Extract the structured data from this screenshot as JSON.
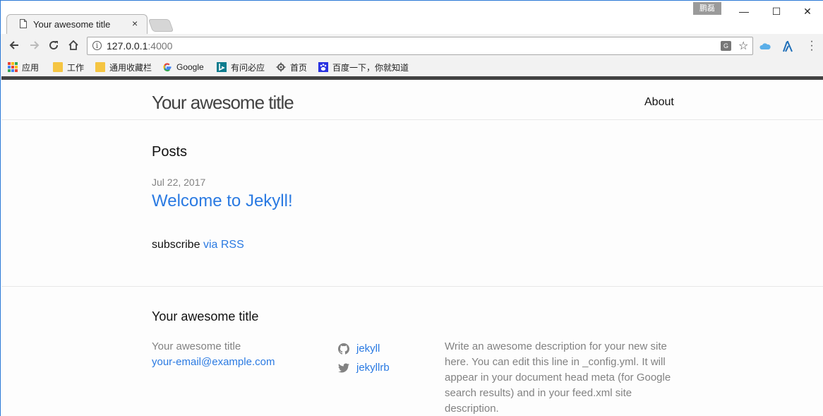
{
  "browser": {
    "tab_title": "Your awesome title",
    "tab_close": "×",
    "user_badge": "鹏磊",
    "window_controls": {
      "minimize": "—",
      "maximize": "☐",
      "close": "✕"
    },
    "url_host": "127.0.0.1",
    "url_port": ":4000",
    "bookmarks": [
      {
        "label": "应用",
        "icon": "apps-icon"
      },
      {
        "label": "工作",
        "icon": "folder-icon"
      },
      {
        "label": "通用收藏栏",
        "icon": "folder-icon"
      },
      {
        "label": "Google",
        "icon": "google-icon"
      },
      {
        "label": "有问必应",
        "icon": "bing-icon"
      },
      {
        "label": "首页",
        "icon": "gear-icon"
      },
      {
        "label": "百度一下，你就知道",
        "icon": "baidu-icon"
      }
    ]
  },
  "site": {
    "title": "Your awesome title",
    "nav": {
      "about": "About"
    }
  },
  "main": {
    "posts_heading": "Posts",
    "posts": [
      {
        "date": "Jul 22, 2017",
        "title": "Welcome to Jekyll!"
      }
    ],
    "subscribe_text": "subscribe",
    "subscribe_link": "via RSS"
  },
  "footer": {
    "heading": "Your awesome title",
    "name": "Your awesome title",
    "email": "your-email@example.com",
    "github": "jekyll",
    "twitter": "jekyllrb",
    "description": "Write an awesome description for your new site here. You can edit this line in _config.yml. It will appear in your document head meta (for Google search results) and in your feed.xml site description."
  },
  "colors": {
    "link": "#2a7ae2",
    "header_border": "#424242",
    "muted": "#828282"
  }
}
